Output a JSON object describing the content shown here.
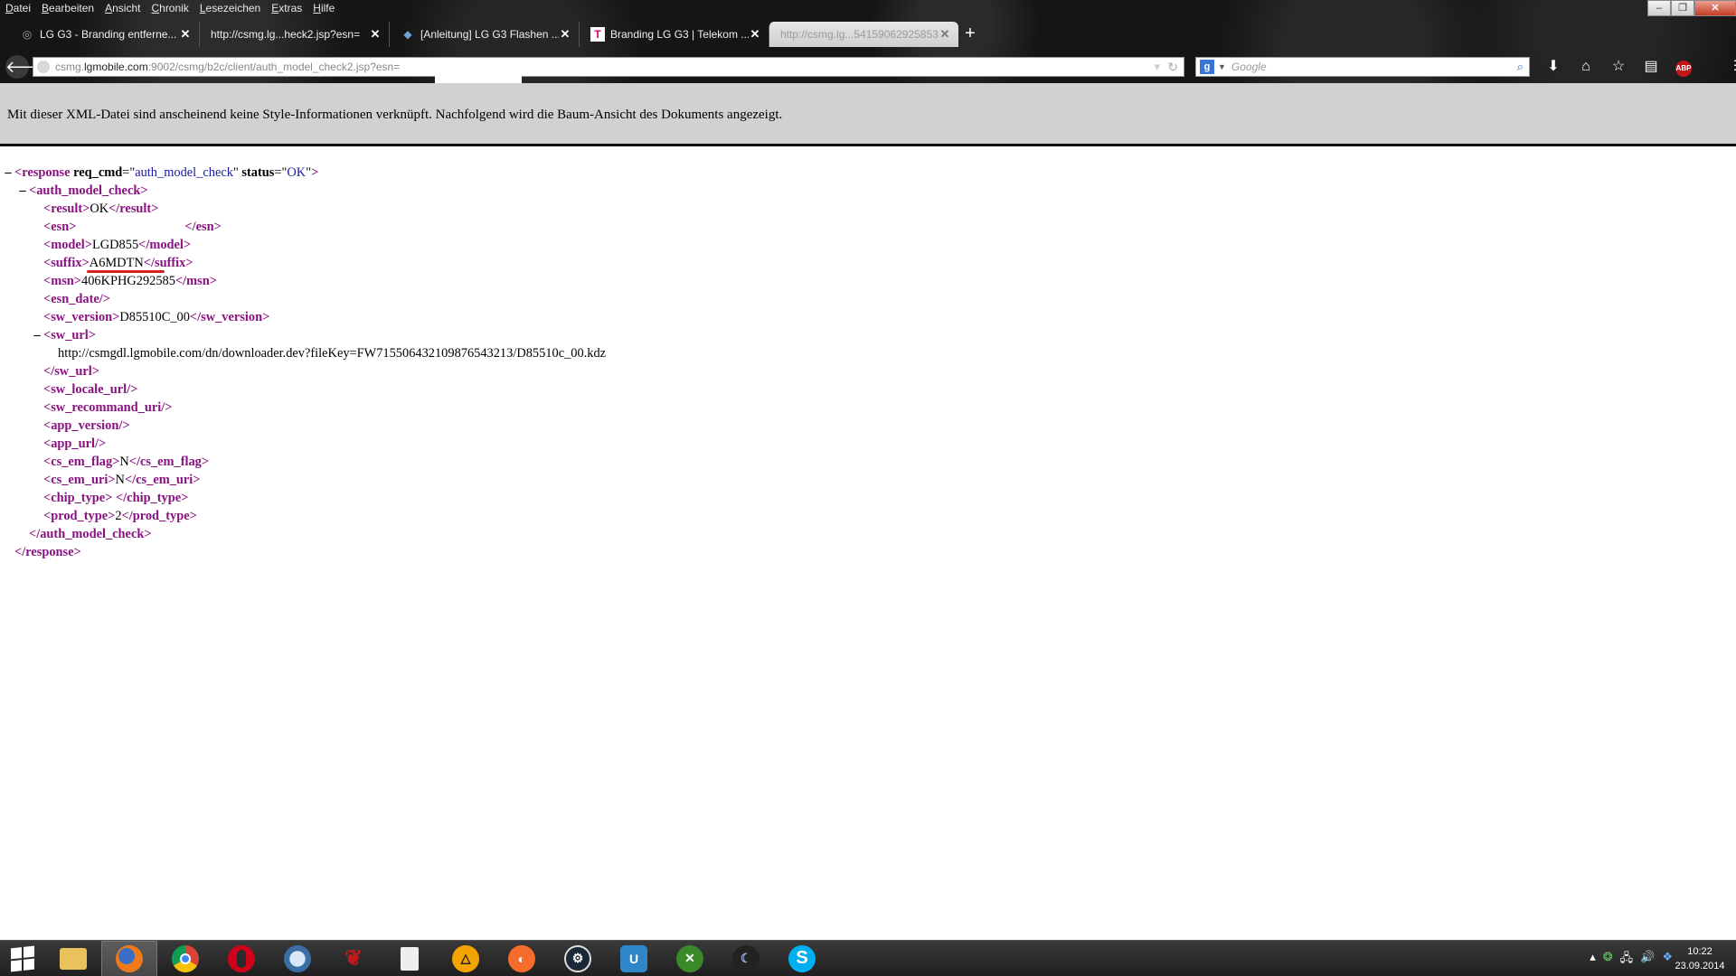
{
  "menu": [
    "Datei",
    "Bearbeiten",
    "Ansicht",
    "Chronik",
    "Lesezeichen",
    "Extras",
    "Hilfe"
  ],
  "window_controls": {
    "minimize": "–",
    "maximize": "❐",
    "close": "✕"
  },
  "tabs": [
    {
      "title": "LG G3 - Branding entferne...",
      "icon": "globe-icon"
    },
    {
      "title": "http://csmg.lg...heck2.jsp?esn=",
      "icon": "page-icon"
    },
    {
      "title": "[Anleitung] LG G3 Flashen ...",
      "icon": "forum-icon"
    },
    {
      "title": "Branding LG G3 | Telekom ...",
      "icon": "telekom-icon"
    },
    {
      "title": "http://csmg.lg...54159062925853",
      "icon": "none",
      "active": true
    }
  ],
  "url": {
    "prefix": "csmg.",
    "host": "lgmobile.com",
    "rest": ":9002/csmg/b2c/client/auth_model_check2.jsp?esn="
  },
  "search": {
    "placeholder": "Google",
    "engine": "g"
  },
  "info_text": "Mit dieser XML-Datei sind anscheinend keine Style-Informationen verknüpft. Nachfolgend wird die Baum-Ansicht des Dokuments angezeigt.",
  "xml": {
    "root": {
      "tag": "response",
      "attrs": [
        {
          "name": "req_cmd",
          "value": "auth_model_check"
        },
        {
          "name": "status",
          "value": "OK"
        }
      ]
    },
    "child": "auth_model_check",
    "result": "OK",
    "esn": "",
    "model": "LGD855",
    "suffix": "A6MDTN",
    "msn": "406KPHG292585",
    "sw_version": "D85510C_00",
    "sw_url": "http://csmgdl.lgmobile.com/dn/downloader.dev?fileKey=FW715506432109876543213/D85510c_00.kdz",
    "cs_em_flag": "N",
    "cs_em_uri": "N",
    "chip_type": " ",
    "prod_type": "2"
  },
  "taskbar_apps": [
    "file-explorer",
    "firefox",
    "chrome",
    "opera",
    "thunderbird",
    "dragon-app",
    "file",
    "vlc-media-player",
    "origin",
    "steam",
    "uplay",
    "xbox",
    "spotify-style",
    "skype"
  ],
  "clock": {
    "time": "10:22",
    "date": "23.09.2014"
  }
}
